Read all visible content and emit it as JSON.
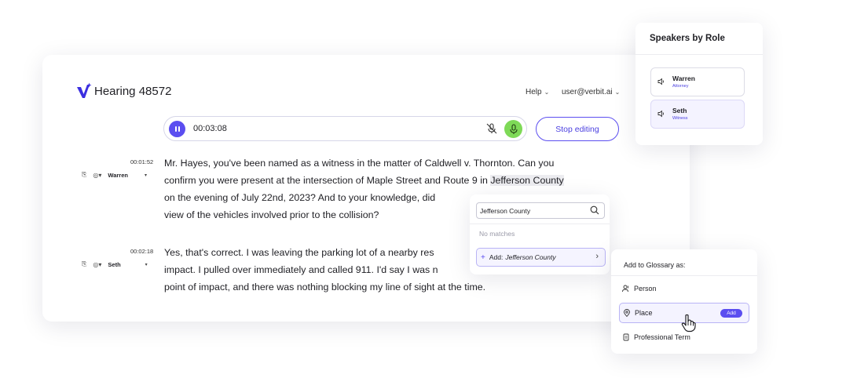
{
  "app": {
    "title": "Hearing 48572"
  },
  "topnav": {
    "help": "Help",
    "user": "user@verbit.ai"
  },
  "player": {
    "timecode": "00:03:08",
    "stop_label": "Stop editing"
  },
  "segments": [
    {
      "time": "00:01:52",
      "speaker": "Warren",
      "lines": [
        "Mr. Hayes, you've been named as a witness in the matter of Caldwell v. Thornton. Can you",
        "confirm you were present at the intersection of Maple Street and Route 9 in ",
        "on the evening of July 22nd, 2023? And to your knowledge, did",
        "view of the vehicles involved prior to the collision?"
      ],
      "highlight": "Jefferson County"
    },
    {
      "time": "00:02:18",
      "speaker": "Seth",
      "lines": [
        "Yes, that's correct. I was leaving the parking lot of a nearby res",
        "impact. I pulled over immediately and called 911. I'd say I was n",
        "point of impact, and there was nothing blocking my line of sight at the time."
      ]
    }
  ],
  "search_popup": {
    "query": "Jefferson County",
    "no_matches": "No matches",
    "add_prefix": "Add:",
    "add_term": "Jefferson County"
  },
  "speakers_panel": {
    "title": "Speakers by Role",
    "items": [
      {
        "name": "Warren",
        "role": "Attorney"
      },
      {
        "name": "Seth",
        "role": "Witness"
      }
    ]
  },
  "glossary_popup": {
    "title": "Add to Glossary as:",
    "items": [
      {
        "label": "Person",
        "icon": "person-icon"
      },
      {
        "label": "Place",
        "icon": "location-pin-icon"
      },
      {
        "label": "Professional Term",
        "icon": "document-icon"
      }
    ],
    "add_badge": "Add"
  },
  "colors": {
    "accent": "#5b4ef0",
    "mic_active": "#7ed957"
  }
}
